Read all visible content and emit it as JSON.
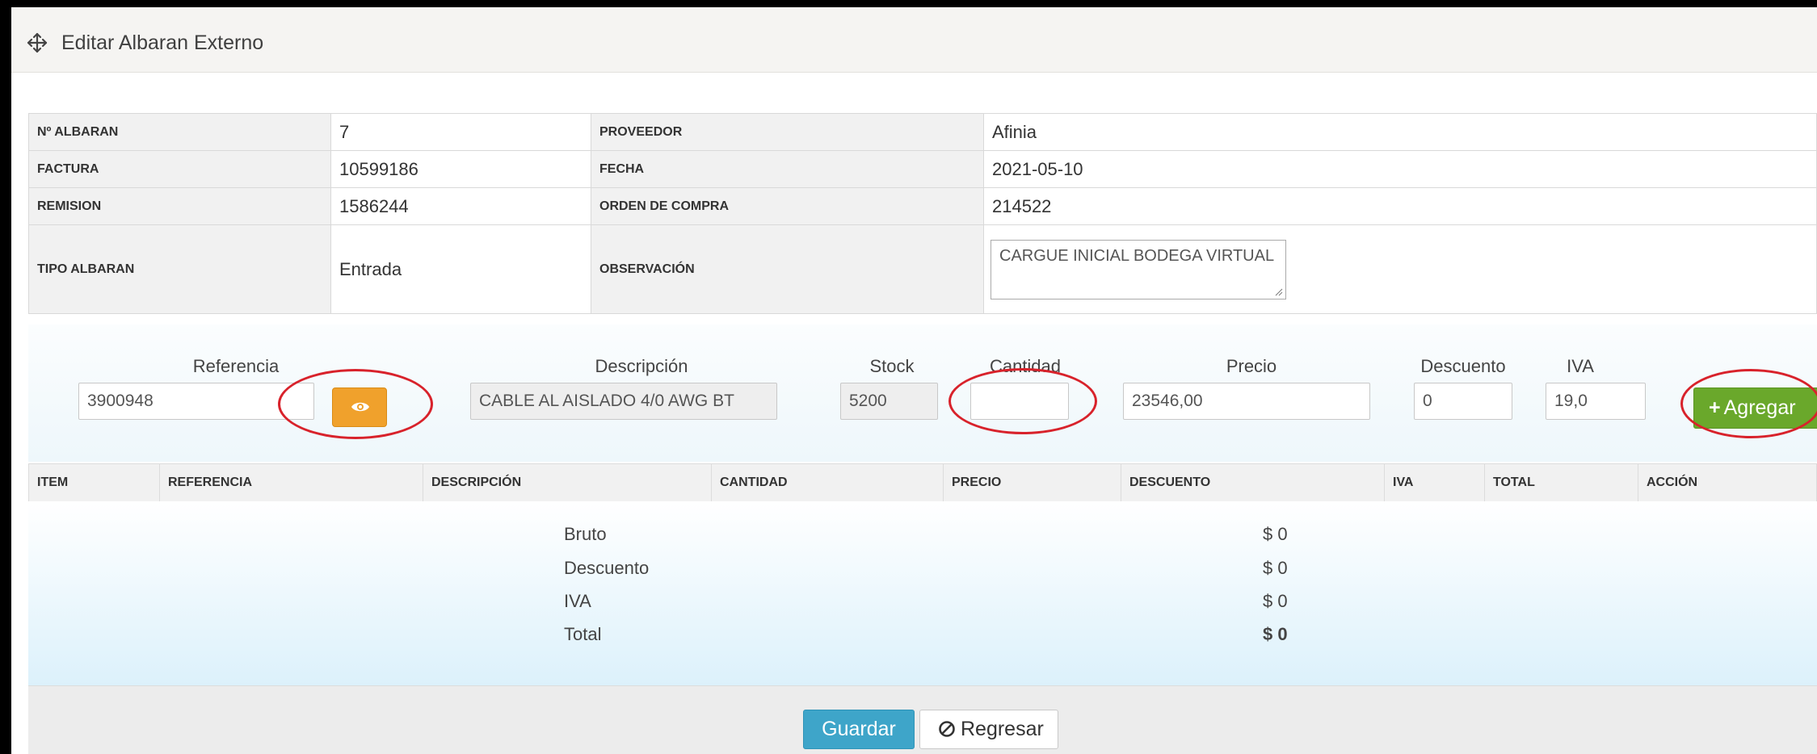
{
  "header": {
    "title": "Editar Albaran Externo"
  },
  "info": {
    "rows": [
      {
        "label1": "Nº ALBARAN",
        "value1": "7",
        "label2": "PROVEEDOR",
        "value2": "Afinia"
      },
      {
        "label1": "FACTURA",
        "value1": "10599186",
        "label2": "FECHA",
        "value2": "2021-05-10"
      },
      {
        "label1": "REMISION",
        "value1": "1586244",
        "label2": "ORDEN DE COMPRA",
        "value2": "214522"
      },
      {
        "label1": "TIPO ALBARAN",
        "value1": "Entrada",
        "label2": "OBSERVACIÓN",
        "value2": "CARGUE INICIAL BODEGA VIRTUAL"
      }
    ]
  },
  "form": {
    "referencia": {
      "label": "Referencia",
      "value": "3900948"
    },
    "descripcion": {
      "label": "Descripción",
      "value": "CABLE AL AISLADO 4/0 AWG BT"
    },
    "stock": {
      "label": "Stock",
      "value": "5200"
    },
    "cantidad": {
      "label": "Cantidad",
      "value": ""
    },
    "precio": {
      "label": "Precio",
      "value": "23546,00"
    },
    "descuento": {
      "label": "Descuento",
      "value": "0"
    },
    "iva": {
      "label": "IVA",
      "value": "19,0"
    },
    "add_label": "Agregar"
  },
  "items_table": {
    "headers": [
      "ITEM",
      "REFERENCIA",
      "DESCRIPCIÓN",
      "CANTIDAD",
      "PRECIO",
      "DESCUENTO",
      "IVA",
      "TOTAL",
      "ACCIÓN"
    ],
    "rows": []
  },
  "totals": {
    "bruto_label": "Bruto",
    "bruto_value": "$ 0",
    "descuento_label": "Descuento",
    "descuento_value": "$ 0",
    "iva_label": "IVA",
    "iva_value": "$ 0",
    "total_label": "Total",
    "total_value": "$ 0"
  },
  "footer": {
    "save_label": "Guardar",
    "back_label": "Regresar"
  },
  "icons": {
    "title": "move-arrows-icon",
    "view": "eye-icon",
    "add": "plus-icon",
    "back": "ban-icon"
  },
  "colors": {
    "view_button": "#f0a12c",
    "add_button": "#6aa82b",
    "save_button": "#3ea5c9",
    "annotation": "#d8222b"
  }
}
